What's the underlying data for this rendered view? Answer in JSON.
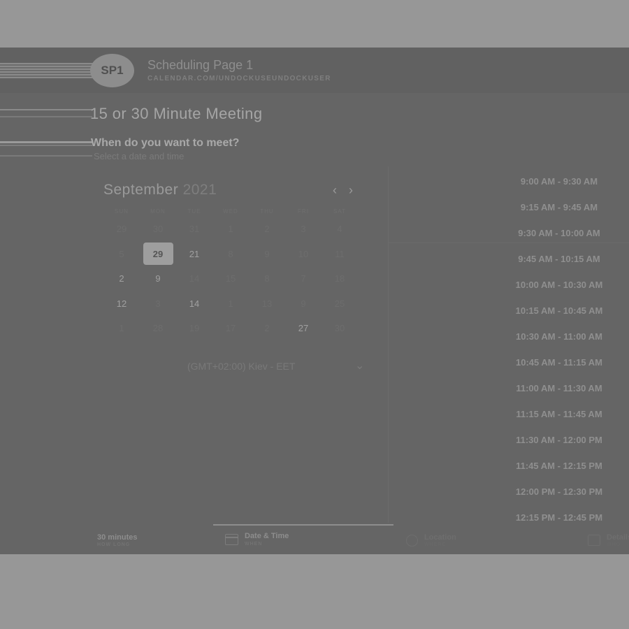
{
  "header": {
    "avatar_initials": "SP1",
    "page_name": "Scheduling Page 1",
    "page_url": "CALENDAR.COM/UNDOCKUSEUNDOCKUSER"
  },
  "meeting": {
    "title": "15 or 30 Minute Meeting",
    "question": "When do you want to meet?",
    "subtext": "Select a date and time"
  },
  "calendar": {
    "month": "September",
    "year": "2021",
    "prev_icon": "chevron-left-icon",
    "next_icon": "chevron-right-icon",
    "weekdays": [
      "SUN",
      "MON",
      "TUE",
      "WED",
      "THU",
      "FRI",
      "SAT"
    ],
    "weeks": [
      [
        {
          "d": "29",
          "s": "dim"
        },
        {
          "d": "30",
          "s": "dim"
        },
        {
          "d": "31",
          "s": "dim"
        },
        {
          "d": "1",
          "s": "dim"
        },
        {
          "d": "2",
          "s": "dim"
        },
        {
          "d": "3",
          "s": "dim"
        },
        {
          "d": "4",
          "s": "dim"
        }
      ],
      [
        {
          "d": "5",
          "s": "dim"
        },
        {
          "d": "29",
          "s": "selected"
        },
        {
          "d": "21",
          "s": "avail"
        },
        {
          "d": "8",
          "s": "dim"
        },
        {
          "d": "9",
          "s": "dim"
        },
        {
          "d": "10",
          "s": "dim"
        },
        {
          "d": "11",
          "s": "dim"
        }
      ],
      [
        {
          "d": "2",
          "s": "avail"
        },
        {
          "d": "9",
          "s": "avail"
        },
        {
          "d": "14",
          "s": "dim"
        },
        {
          "d": "15",
          "s": "dim"
        },
        {
          "d": "8",
          "s": "dim"
        },
        {
          "d": "7",
          "s": "dim"
        },
        {
          "d": "18",
          "s": "dim"
        }
      ],
      [
        {
          "d": "12",
          "s": "avail"
        },
        {
          "d": "3",
          "s": "dim"
        },
        {
          "d": "14",
          "s": "avail"
        },
        {
          "d": "1",
          "s": "dim"
        },
        {
          "d": "13",
          "s": "dim"
        },
        {
          "d": "9",
          "s": "dim"
        },
        {
          "d": "25",
          "s": "dim"
        }
      ],
      [
        {
          "d": "1",
          "s": "dim"
        },
        {
          "d": "28",
          "s": "dim"
        },
        {
          "d": "19",
          "s": "dim"
        },
        {
          "d": "17",
          "s": "dim"
        },
        {
          "d": "2",
          "s": "dim"
        },
        {
          "d": "27",
          "s": "avail"
        },
        {
          "d": "30",
          "s": "dim"
        }
      ]
    ],
    "timezone": "(GMT+02:00) Kiev - EET"
  },
  "time_slots": [
    "9:00 AM - 9:30 AM",
    "9:15 AM - 9:45 AM",
    "9:30 AM - 10:00 AM",
    "9:45 AM - 10:15 AM",
    "10:00 AM - 10:30 AM",
    "10:15 AM - 10:45 AM",
    "10:30 AM - 11:00 AM",
    "10:45 AM - 11:15 AM",
    "11:00 AM - 11:30 AM",
    "11:15 AM - 11:45 AM",
    "11:30 AM - 12:00 PM",
    "11:45 AM - 12:15 PM",
    "12:00 PM - 12:30 PM",
    "12:15 PM - 12:45 PM"
  ],
  "footer": {
    "duration": "30 minutes",
    "duration_sub": "HOW LONG",
    "step_datetime": "Date & Time",
    "step_datetime_sub": "WHEN",
    "step_location": "Location",
    "step_location_sub": "WHERE",
    "step_details": "Details",
    "step_details_sub": "WHO",
    "datetime_icon": "calendar-icon",
    "location_icon": "location-pin-icon",
    "details_icon": "notepad-icon"
  }
}
